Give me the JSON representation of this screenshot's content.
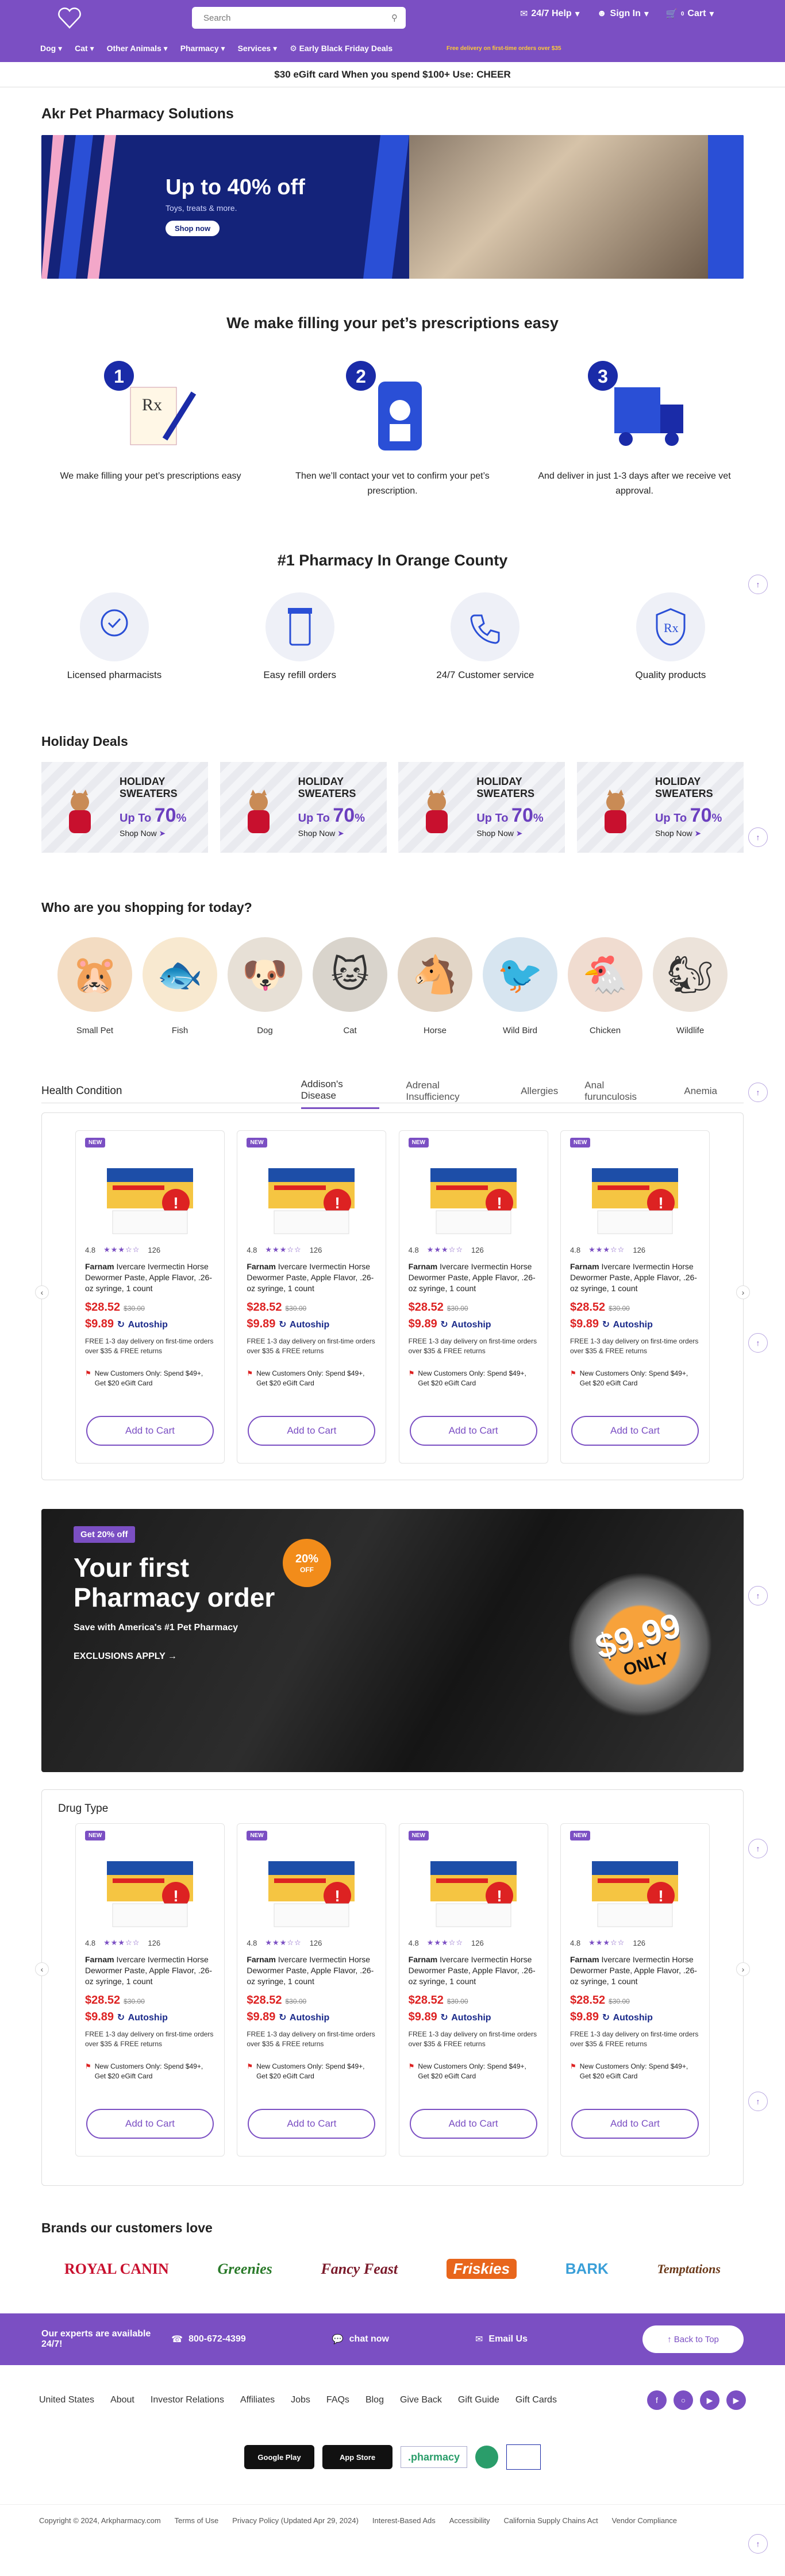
{
  "header": {
    "search_placeholder": "Search",
    "help_label": "24/7 Help",
    "signin_label": "Sign In",
    "cart_label": "Cart",
    "cart_count": "0",
    "nav": [
      "Dog",
      "Cat",
      "Other Animals",
      "Pharmacy",
      "Services",
      "Early Black Friday Deals"
    ],
    "promo": "Free delivery on first-time orders over $35"
  },
  "egift_banner": "$30 eGift card When you spend $100+ Use: CHEER",
  "page_title": "Akr Pet Pharmacy Solutions",
  "hero": {
    "headline": "Up to 40% off",
    "sub": "Toys, treats & more.",
    "button": "Shop now"
  },
  "how": {
    "title": "We make filling your pet’s prescriptions easy",
    "steps": [
      {
        "num": "1",
        "text": "We make filling your pet’s prescriptions easy"
      },
      {
        "num": "2",
        "text": "Then we’ll contact your vet to confirm your pet’s prescription."
      },
      {
        "num": "3",
        "text": "And deliver in just 1-3 days after we receive vet approval."
      }
    ]
  },
  "pharmacy": {
    "title": "#1 Pharmacy In Orange County",
    "features": [
      "Licensed pharmacists",
      "Easy refill orders",
      "24/7 Customer service",
      "Quality products"
    ]
  },
  "holiday": {
    "title": "Holiday Deals",
    "line1": "HOLIDAY",
    "line2": "SWEATERS",
    "upto": "Up To",
    "pct": "70",
    "shop": "Shop Now"
  },
  "shopping": {
    "title": "Who are you shopping for today?",
    "pets": [
      "Small Pet",
      "Fish",
      "Dog",
      "Cat",
      "Horse",
      "Wild Bird",
      "Chicken",
      "Wildlife"
    ]
  },
  "health": {
    "label": "Health Condition",
    "tabs": [
      "Addison's Disease",
      "Adrenal Insufficiency",
      "Allergies",
      "Anal furunculosis",
      "Anemia"
    ]
  },
  "product": {
    "badge": "NEW",
    "rating": "4.8",
    "reviews": "126",
    "brand": "Farnam",
    "name": "Ivercare Ivermectin Horse Dewormer Paste, Apple Flavor, .26-oz syringe, 1 count",
    "price": "$28.52",
    "was": "$30.00",
    "autoship_price": "$9.89",
    "autoship_label": "Autoship",
    "shipping": "FREE 1-3 day delivery on first-time orders over $35 & FREE returns",
    "coupon": "New Customers Only: Spend $49+, Get $20 eGift Card",
    "cta": "Add to Cart"
  },
  "first_order": {
    "pill": "Get 20% off",
    "headline1": "Your first",
    "headline2": "Pharmacy order",
    "sub": "Save with America's #1 Pet Pharmacy",
    "exclusions": "EXCLUSIONS APPLY",
    "badge_pct": "20%",
    "badge_off": "OFF",
    "price": "$9.99",
    "only": "ONLY"
  },
  "drug_type": {
    "label": "Drug Type"
  },
  "brands": {
    "title": "Brands our customers love",
    "items": [
      "ROYAL CANIN",
      "Greenies",
      "Fancy Feast",
      "Friskies",
      "BARK",
      "Temptations"
    ]
  },
  "cta": {
    "experts": "Our experts are available 24/7!",
    "phone": "800-672-4399",
    "chat": "chat now",
    "email": "Email Us",
    "top": "Back to Top"
  },
  "footer": {
    "links": [
      "United States",
      "About",
      "Investor Relations",
      "Affiliates",
      "Jobs",
      "FAQs",
      "Blog",
      "Give Back",
      "Gift Guide",
      "Gift Cards"
    ],
    "google": "Google Play",
    "apple": "App Store",
    "pharmacy": ".pharmacy",
    "copyright": "Copyright © 2024, Arkpharmacy.com",
    "legal": [
      "Terms of Use",
      "Privacy Policy (Updated Apr 29, 2024)",
      "Interest-Based Ads",
      "Accessibility",
      "California Supply Chains Act",
      "Vendor Compliance"
    ]
  },
  "colors": {
    "brand": "#7b4fc3",
    "price": "#dd2222",
    "hero_bg": "#14237a"
  }
}
